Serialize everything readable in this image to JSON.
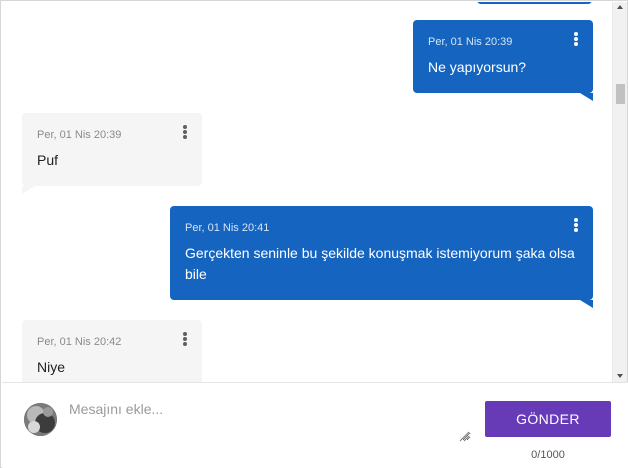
{
  "messages": [
    {
      "direction": "out",
      "time": "Per, 01 Nis 20:39",
      "text": "Ne yapıyorsun?"
    },
    {
      "direction": "in",
      "time": "Per, 01 Nis 20:39",
      "text": "Puf"
    },
    {
      "direction": "out",
      "time": "Per, 01 Nis 20:41",
      "text": "Gerçekten seninle bu şekilde konuşmak istemiyorum şaka olsa bile"
    },
    {
      "direction": "in",
      "time": "Per, 01 Nis 20:42",
      "text": "Niye"
    }
  ],
  "composer": {
    "placeholder": "Mesajını ekle...",
    "send_label": "GÖNDER",
    "counter": "0/1000"
  },
  "colors": {
    "outgoing_bubble": "#1565c0",
    "incoming_bubble": "#f5f5f5",
    "send_button": "#673ab7"
  },
  "icons": [
    "more-vert-icon",
    "avatar",
    "resize-handle-icon"
  ]
}
